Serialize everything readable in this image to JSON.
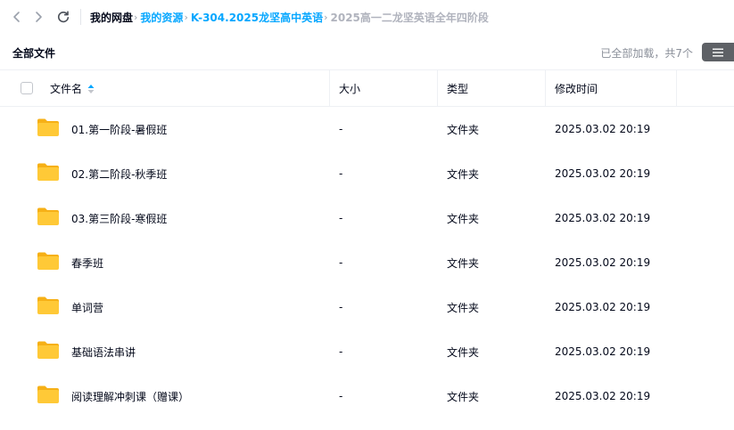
{
  "nav": {
    "back_icon": "chevron-left-icon",
    "forward_icon": "chevron-right-icon",
    "refresh_icon": "refresh-icon"
  },
  "breadcrumb": {
    "items": [
      {
        "label": "我的网盘"
      },
      {
        "label": "我的资源"
      },
      {
        "label": "K-304.2025龙坚高中英语"
      },
      {
        "label": "2025高一二龙坚英语全年四阶段"
      }
    ],
    "separator": "›"
  },
  "toolbar": {
    "title": "全部文件",
    "loaded_text": "已全部加载，共7个",
    "view_icon": "list-view-icon"
  },
  "table": {
    "columns": {
      "name": "文件名",
      "size": "大小",
      "type": "类型",
      "modified": "修改时间"
    },
    "rows": [
      {
        "name": "01.第一阶段-暑假班",
        "size": "-",
        "type": "文件夹",
        "modified": "2025.03.02 20:19",
        "icon": "folder-icon"
      },
      {
        "name": "02.第二阶段-秋季班",
        "size": "-",
        "type": "文件夹",
        "modified": "2025.03.02 20:19",
        "icon": "folder-icon"
      },
      {
        "name": "03.第三阶段-寒假班",
        "size": "-",
        "type": "文件夹",
        "modified": "2025.03.02 20:19",
        "icon": "folder-icon"
      },
      {
        "name": "春季班",
        "size": "-",
        "type": "文件夹",
        "modified": "2025.03.02 20:19",
        "icon": "folder-icon"
      },
      {
        "name": "单词营",
        "size": "-",
        "type": "文件夹",
        "modified": "2025.03.02 20:19",
        "icon": "folder-icon"
      },
      {
        "name": "基础语法串讲",
        "size": "-",
        "type": "文件夹",
        "modified": "2025.03.02 20:19",
        "icon": "folder-icon"
      },
      {
        "name": "阅读理解冲刺课（赠课）",
        "size": "-",
        "type": "文件夹",
        "modified": "2025.03.02 20:19",
        "icon": "folder-icon"
      }
    ]
  },
  "colors": {
    "accent": "#06a7ff",
    "folder": "#ffc937",
    "folder_back": "#f6b016"
  }
}
